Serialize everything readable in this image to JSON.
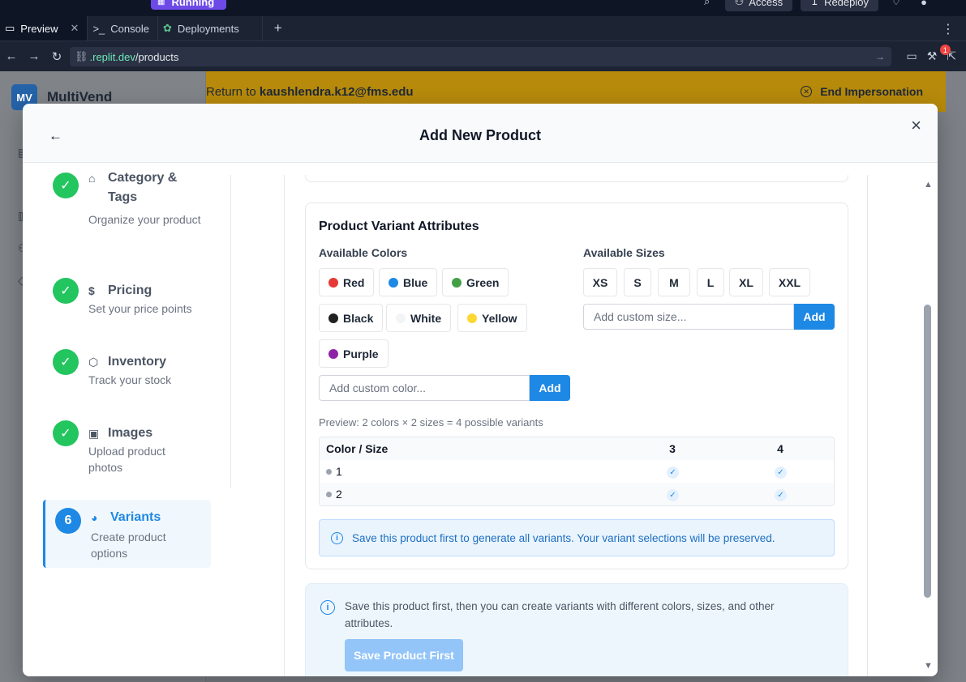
{
  "chrome": {
    "run_label": "Running",
    "access_label": "Access",
    "redeploy_label": "Redeploy",
    "tabs": [
      {
        "label": "Preview",
        "icon": "monitor-icon"
      },
      {
        "label": "Console",
        "icon": "terminal-icon"
      },
      {
        "label": "Deployments",
        "icon": "deploy-icon"
      }
    ],
    "url_host": ".replit.dev",
    "url_path": "/products",
    "notif_count": "1"
  },
  "app": {
    "logo": "MV",
    "name": "MultiVend",
    "banner_prefix": "Return to ",
    "banner_email": "kaushlendra.k12@fms.edu",
    "end_impersonation": "End Impersonation"
  },
  "modal": {
    "title": "Add New Product",
    "steps": [
      {
        "number": "✓",
        "title_line1": "Category &",
        "title_line2": "Tags",
        "desc": "Organize your product",
        "icon": "tag-icon",
        "status": "complete"
      },
      {
        "number": "✓",
        "title_line1": "Pricing",
        "title_line2": "",
        "desc": "Set your price points",
        "icon": "dollar-icon",
        "status": "complete"
      },
      {
        "number": "✓",
        "title_line1": "Inventory",
        "title_line2": "",
        "desc": "Track your stock",
        "icon": "box-icon",
        "status": "complete"
      },
      {
        "number": "✓",
        "title_line1": "Images",
        "title_line2": "",
        "desc": "Upload product photos",
        "icon": "image-icon",
        "status": "complete"
      },
      {
        "number": "6",
        "title_line1": "Variants",
        "title_line2": "",
        "desc": "Create product options",
        "icon": "palette-icon",
        "status": "active"
      }
    ],
    "variants": {
      "title": "Product Variant Attributes",
      "colors_label": "Available Colors",
      "sizes_label": "Available Sizes",
      "colors": [
        {
          "name": "Red",
          "hex": "#e53935"
        },
        {
          "name": "Blue",
          "hex": "#1e88e5"
        },
        {
          "name": "Green",
          "hex": "#43a047"
        },
        {
          "name": "Black",
          "hex": "#212121"
        },
        {
          "name": "White",
          "hex": "#f3f4f6"
        },
        {
          "name": "Yellow",
          "hex": "#fdd835"
        },
        {
          "name": "Purple",
          "hex": "#8e24aa"
        }
      ],
      "sizes": [
        "XS",
        "S",
        "M",
        "L",
        "XL",
        "XXL"
      ],
      "custom_color_placeholder": "Add custom color...",
      "custom_size_placeholder": "Add custom size...",
      "add_label": "Add",
      "preview_text": "Preview: 2 colors × 2 sizes = 4 possible variants",
      "table": {
        "header": [
          "Color / Size",
          "3",
          "4"
        ],
        "rows": [
          {
            "color": "1",
            "cells": [
              "✓",
              "✓"
            ]
          },
          {
            "color": "2",
            "cells": [
              "✓",
              "✓"
            ]
          }
        ]
      },
      "info": "Save this product first to generate all variants. Your variant selections will be preserved."
    },
    "notice": {
      "text": "Save this product first, then you can create variants with different colors, sizes, and other attributes.",
      "button": "Save Product First"
    }
  }
}
